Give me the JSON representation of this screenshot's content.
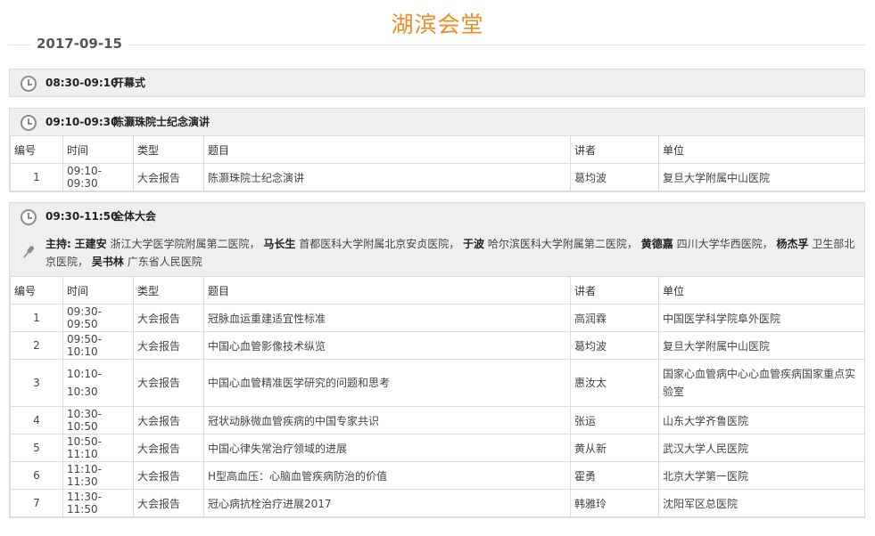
{
  "page": {
    "title": "湖滨会堂",
    "date": "2017-09-15"
  },
  "columns": [
    "编号",
    "时间",
    "类型",
    "题目",
    "讲者",
    "单位"
  ],
  "sessions": [
    {
      "time": "08:30-09:10",
      "title": "开幕式"
    },
    {
      "time": "09:10-09:30",
      "title": "陈灏珠院士纪念演讲",
      "rows": [
        {
          "no": "1",
          "time": "09:10-09:30",
          "type": "大会报告",
          "topic": "陈灏珠院士纪念演讲",
          "speaker": "葛均波",
          "unit": "复旦大学附属中山医院"
        }
      ]
    },
    {
      "time": "09:30-11:50",
      "title": "全体大会",
      "host_label": "主持:",
      "hosts": [
        {
          "name": "王建安",
          "unit": "浙江大学医学院附属第二医院",
          "sep": "，"
        },
        {
          "name": "马长生",
          "unit": "首都医科大学附属北京安贞医院",
          "sep": "，"
        },
        {
          "name": "于波",
          "unit": "哈尔滨医科大学附属第二医院",
          "sep": "，"
        },
        {
          "name": "黄德嘉",
          "unit": "四川大学华西医院",
          "sep": "，"
        },
        {
          "name": "杨杰孚",
          "unit": "卫生部北京医院",
          "sep": "，"
        },
        {
          "name": "吴书林",
          "unit": "广东省人民医院",
          "sep": ""
        }
      ],
      "rows": [
        {
          "no": "1",
          "time": "09:30-09:50",
          "type": "大会报告",
          "topic": "冠脉血运重建适宜性标准",
          "speaker": "高润霖",
          "unit": "中国医学科学院阜外医院"
        },
        {
          "no": "2",
          "time": "09:50-10:10",
          "type": "大会报告",
          "topic": "中国心血管影像技术纵览",
          "speaker": "葛均波",
          "unit": "复旦大学附属中山医院"
        },
        {
          "no": "3",
          "time": "10:10-10:30",
          "type": "大会报告",
          "topic": "中国心血管精准医学研究的问题和思考",
          "speaker": "惠汝太",
          "unit": "国家心血管病中心心血管疾病国家重点实验室"
        },
        {
          "no": "4",
          "time": "10:30-10:50",
          "type": "大会报告",
          "topic": "冠状动脉微血管疾病的中国专家共识",
          "speaker": "张运",
          "unit": "山东大学齐鲁医院"
        },
        {
          "no": "5",
          "time": "10:50-11:10",
          "type": "大会报告",
          "topic": "中国心律失常治疗领域的进展",
          "speaker": "黄从新",
          "unit": "武汉大学人民医院"
        },
        {
          "no": "6",
          "time": "11:10-11:30",
          "type": "大会报告",
          "topic": "H型高血压：心脑血管疾病防治的价值",
          "speaker": "霍勇",
          "unit": "北京大学第一医院"
        },
        {
          "no": "7",
          "time": "11:30-11:50",
          "type": "大会报告",
          "topic": "冠心病抗栓治疗进展2017",
          "speaker": "韩雅玲",
          "unit": "沈阳军区总医院"
        }
      ]
    }
  ],
  "icons": {
    "session": "clock-icon",
    "host": "microphone-icon"
  },
  "colors": {
    "title": "#f08a24",
    "session_bg": "#efefef",
    "border": "#dcdcdc"
  }
}
